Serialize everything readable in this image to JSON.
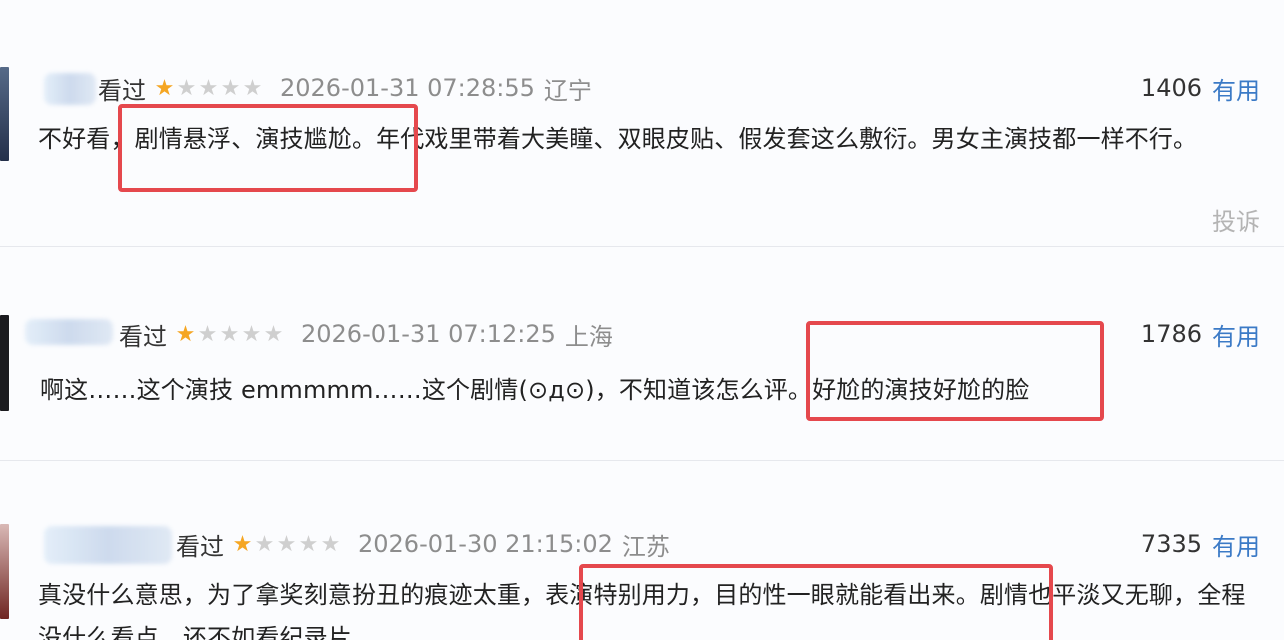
{
  "reviews": [
    {
      "watched_label": "看过",
      "rating": 1,
      "max_rating": 5,
      "timestamp": "2026-01-31 07:28:55",
      "region": "辽宁",
      "votes": "1406",
      "useful_label": "有用",
      "comment": "不好看，剧情悬浮、演技尴尬。年代戏里带着大美瞳、双眼皮贴、假发套这么敷衍。男女主演技都一样不行。",
      "report_label": "投诉"
    },
    {
      "watched_label": "看过",
      "rating": 1,
      "max_rating": 5,
      "timestamp": "2026-01-31 07:12:25",
      "region": "上海",
      "votes": "1786",
      "useful_label": "有用",
      "comment": "啊这……这个演技 emmmmm……这个剧情(⊙д⊙)，不知道该怎么评。好尬的演技好尬的脸"
    },
    {
      "watched_label": "看过",
      "rating": 1,
      "max_rating": 5,
      "timestamp": "2026-01-30 21:15:02",
      "region": "江苏",
      "votes": "7335",
      "useful_label": "有用",
      "comment": "真没什么意思，为了拿奖刻意扮丑的痕迹太重，表演特别用力，目的性一眼就能看出来。剧情也平淡又无聊，全程没什么看点，还不如看纪录片"
    }
  ],
  "colors": {
    "star_filled": "#f5a623",
    "star_empty": "#cfcfcf",
    "link_blue": "#3b7ac6",
    "highlight_red": "#e5484d",
    "meta_gray": "#8d8d8d"
  }
}
